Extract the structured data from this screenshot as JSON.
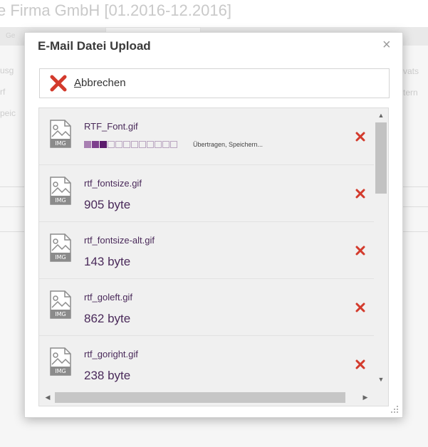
{
  "background": {
    "title": "e Firma GmbH   [01.2016-12.2016]",
    "tabs": [
      "Ge",
      ""
    ],
    "left_fragments": [
      "usg",
      "rf",
      "peic"
    ],
    "right_fragments": [
      "vats",
      "tern"
    ]
  },
  "dialog": {
    "title": "E-Mail Datei Upload",
    "close_glyph": "×",
    "cancel_button": {
      "accel": "A",
      "rest": "bbrechen"
    },
    "files": [
      {
        "name": "RTF_Font.gif",
        "icon_label": "IMG",
        "uploading": true,
        "progress_cells": 12,
        "filled_cells": 3,
        "status": "Übertragen, Speichern..."
      },
      {
        "name": "rtf_fontsize.gif",
        "icon_label": "IMG",
        "size": "905 byte"
      },
      {
        "name": "rtf_fontsize-alt.gif",
        "icon_label": "IMG",
        "size": "143 byte"
      },
      {
        "name": "rtf_goleft.gif",
        "icon_label": "IMG",
        "size": "862 byte"
      },
      {
        "name": "rtf_goright.gif",
        "icon_label": "IMG",
        "size": "238 byte"
      }
    ],
    "scroll": {
      "up": "▲",
      "down": "▼",
      "left": "◀",
      "right": "▶"
    }
  },
  "colors": {
    "accent_red": "#d33a2c",
    "file_text": "#4a2a5a",
    "progress": "#5b1b6c"
  }
}
